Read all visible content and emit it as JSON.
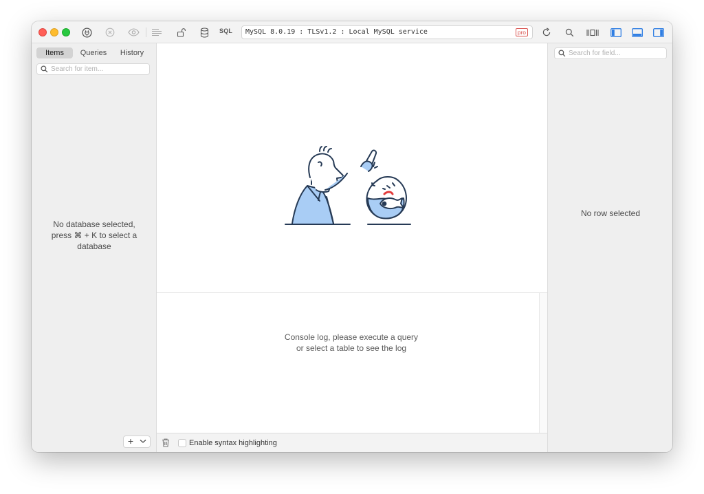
{
  "toolbar": {
    "sql_label": "SQL",
    "connection": "MySQL 8.0.19 : TLSv1.2 : Local MySQL service",
    "badge": "pro"
  },
  "left_sidebar": {
    "tabs": [
      {
        "label": "Items",
        "active": true
      },
      {
        "label": "Queries",
        "active": false
      },
      {
        "label": "History",
        "active": false
      }
    ],
    "search_placeholder": "Search for item...",
    "empty_lines": [
      "No database selected,",
      "press ⌘ + K to select a",
      "database"
    ],
    "add_label": "+"
  },
  "console": {
    "lines": [
      "Console log, please execute a query",
      "or select a table to see the log"
    ],
    "syntax_label": "Enable syntax highlighting",
    "syntax_checked": false
  },
  "right_sidebar": {
    "search_placeholder": "Search for field...",
    "empty_text": "No row selected"
  },
  "colors": {
    "accent": "#2f7ee3",
    "illustration_line": "#263a55",
    "illustration_fill": "#a9cdf5",
    "badge_red": "#d9534f"
  }
}
